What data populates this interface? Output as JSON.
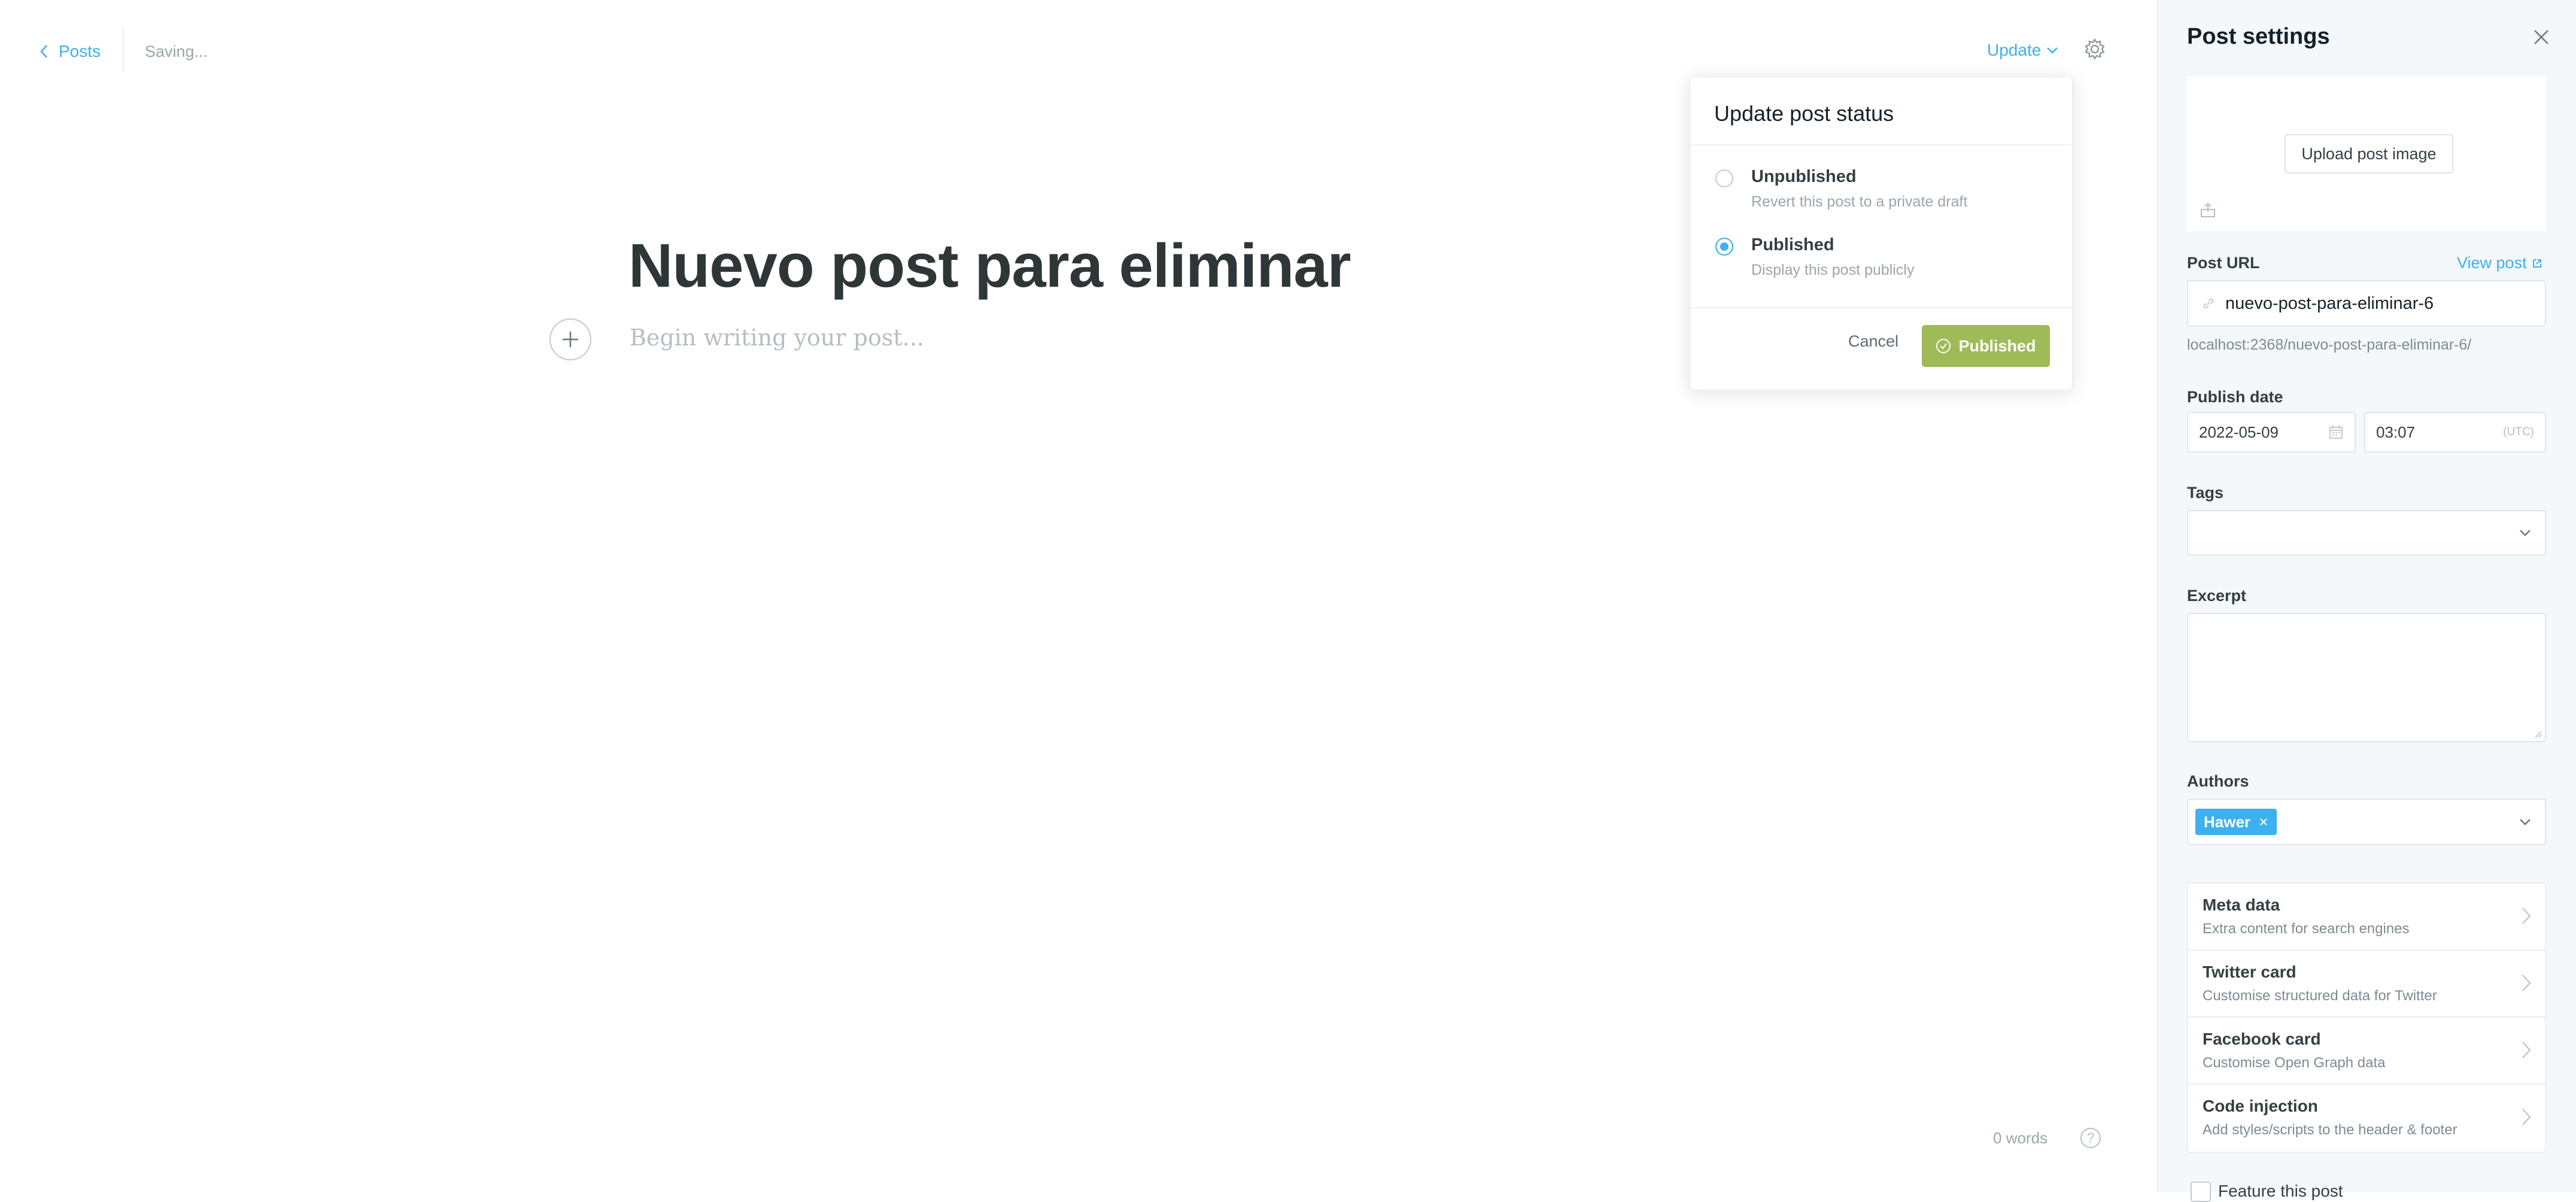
{
  "header": {
    "back_label": "Posts",
    "status": "Saving...",
    "update_label": "Update"
  },
  "editor": {
    "title": "Nuevo post para eliminar",
    "body_placeholder": "Begin writing your post...",
    "word_count": "0 words"
  },
  "popup": {
    "title": "Update post status",
    "options": [
      {
        "label": "Unpublished",
        "description": "Revert this post to a private draft",
        "selected": false
      },
      {
        "label": "Published",
        "description": "Display this post publicly",
        "selected": true
      }
    ],
    "cancel_label": "Cancel",
    "confirm_label": "Published"
  },
  "sidebar": {
    "title": "Post settings",
    "upload_label": "Upload post image",
    "post_url_label": "Post URL",
    "view_post_label": "View post",
    "post_url_value": "nuevo-post-para-eliminar-6",
    "url_hint": "localhost:2368/nuevo-post-para-eliminar-6/",
    "publish_date_label": "Publish date",
    "date_value": "2022-05-09",
    "time_value": "03:07",
    "timezone": "(UTC)",
    "tags_label": "Tags",
    "excerpt_label": "Excerpt",
    "authors_label": "Authors",
    "author_chip": "Hawer",
    "menu": [
      {
        "title": "Meta data",
        "description": "Extra content for search engines"
      },
      {
        "title": "Twitter card",
        "description": "Customise structured data for Twitter"
      },
      {
        "title": "Facebook card",
        "description": "Customise Open Graph data"
      },
      {
        "title": "Code injection",
        "description": "Add styles/scripts to the header & footer"
      }
    ],
    "feature_label": "Feature this post"
  },
  "colors": {
    "accent": "#3eb0ef",
    "publish_green": "#9fbb58"
  }
}
